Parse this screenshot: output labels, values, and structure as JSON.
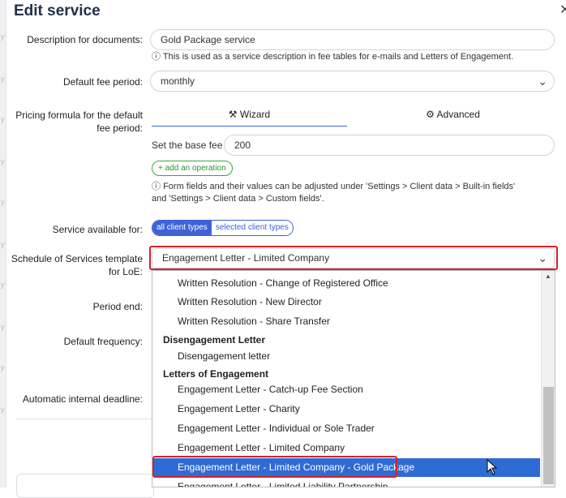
{
  "dialog": {
    "title": "Edit service",
    "close_glyph": "✕"
  },
  "left_strip": {
    "glyphs": [
      "y",
      "y",
      "y",
      "y",
      "y",
      "y",
      "y",
      "y",
      "y",
      "y"
    ]
  },
  "description": {
    "label": "Description for documents:",
    "value": "Gold Package service",
    "hint": "This is used as a service description in fee tables for e-mails and Letters of Engagement."
  },
  "fee_period": {
    "label": "Default fee period:",
    "value": "monthly"
  },
  "pricing": {
    "label_line1": "Pricing formula for the default",
    "label_line2": "fee period:",
    "tabs": [
      {
        "icon": "wand-icon",
        "glyph": "⚒",
        "label": "Wizard"
      },
      {
        "icon": "advanced-gears-icon",
        "glyph": "⚙",
        "label": "Advanced"
      }
    ],
    "base_fee_label": "Set the base fee to:",
    "base_fee_value": "200",
    "add_operation": "+ add an operation",
    "hint_line1": "Form fields and their values can be adjusted under 'Settings > Client data > Built-in fields'",
    "hint_line2": "and 'Settings > Client data > Custom fields'."
  },
  "availability": {
    "label": "Service available for:",
    "options": [
      "all client types",
      "selected client types"
    ],
    "selected": "all client types"
  },
  "schedule": {
    "label_line1": "Schedule of Services template",
    "label_line2": "for LoE:",
    "value": "Engagement Letter - Limited Company"
  },
  "period_end": {
    "label": "Period end:"
  },
  "default_frequency": {
    "label": "Default frequency:"
  },
  "internal_deadline": {
    "label": "Automatic internal deadline:"
  },
  "dropdown": {
    "items": [
      {
        "kind": "option",
        "text": "Written Resolution - Change of Registered Office"
      },
      {
        "kind": "option",
        "text": "Written Resolution - New Director"
      },
      {
        "kind": "option",
        "text": "Written Resolution - Share Transfer"
      },
      {
        "kind": "group",
        "text": "Disengagement Letter"
      },
      {
        "kind": "option",
        "text": "Disengagement letter"
      },
      {
        "kind": "group",
        "text": "Letters of Engagement"
      },
      {
        "kind": "option",
        "text": "Engagement Letter - Catch-up Fee Section"
      },
      {
        "kind": "option",
        "text": "Engagement Letter - Charity"
      },
      {
        "kind": "option",
        "text": "Engagement Letter - Individual or Sole Trader"
      },
      {
        "kind": "option",
        "text": "Engagement Letter - Limited Company"
      },
      {
        "kind": "option",
        "text": "Engagement Letter - Limited Company - Gold Package",
        "highlighted": true
      },
      {
        "kind": "option",
        "text": "Engagement Letter - Limited Liability Partnership"
      }
    ]
  },
  "colors": {
    "accent": "#3e63d6",
    "highlight": "#2f6bd4",
    "annotation": "#d6222a",
    "add_green": "#37a93c"
  }
}
